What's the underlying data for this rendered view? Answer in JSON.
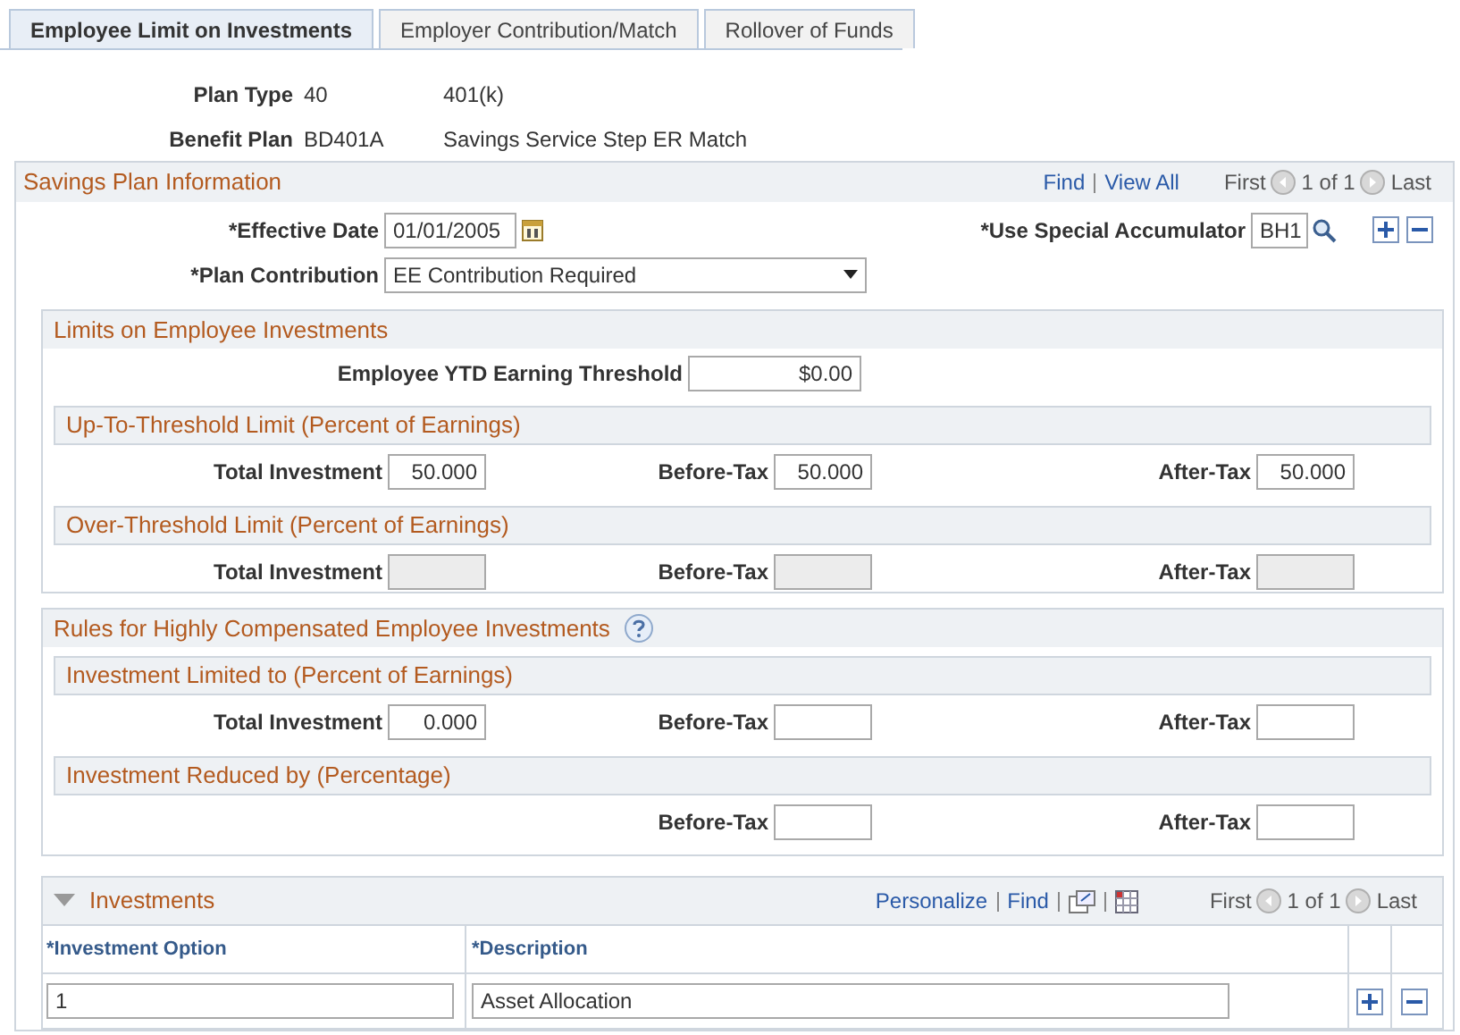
{
  "tabs": [
    {
      "label": "Employee Limit on Investments",
      "selected": true
    },
    {
      "label": "Employer Contribution/Match",
      "selected": false
    },
    {
      "label": "Rollover of Funds",
      "selected": false
    }
  ],
  "header": [
    {
      "label": "Plan Type",
      "code": "40",
      "description": "401(k)"
    },
    {
      "label": "Benefit Plan",
      "code": "BD401A",
      "description": "Savings Service Step ER Match"
    }
  ],
  "savings_plan": {
    "title": "Savings Plan Information",
    "find": "Find",
    "view_all": "View All",
    "first": "First",
    "count": "1 of 1",
    "last": "Last",
    "effective_date": {
      "label": "*Effective Date",
      "value": "01/01/2005"
    },
    "accumulator": {
      "label": "*Use Special Accumulator",
      "value": "BH1"
    },
    "plan_contribution": {
      "label": "*Plan Contribution",
      "value": "EE Contribution Required"
    }
  },
  "limits": {
    "title": "Limits on Employee Investments",
    "threshold": {
      "label": "Employee YTD Earning Threshold",
      "value": "$0.00"
    },
    "groups": [
      {
        "title": "Up-To-Threshold Limit (Percent of Earnings)",
        "fields": [
          {
            "label": "Total Investment",
            "value": "50.000",
            "disabled": false
          },
          {
            "label": "Before-Tax",
            "value": "50.000",
            "disabled": false
          },
          {
            "label": "After-Tax",
            "value": "50.000",
            "disabled": false
          }
        ]
      },
      {
        "title": "Over-Threshold Limit (Percent of Earnings)",
        "fields": [
          {
            "label": "Total Investment",
            "disabled": true
          },
          {
            "label": "Before-Tax",
            "disabled": true
          },
          {
            "label": "After-Tax",
            "disabled": true
          }
        ]
      }
    ]
  },
  "rules": {
    "title": "Rules for Highly Compensated Employee Investments",
    "groups": [
      {
        "title": "Investment Limited to (Percent of Earnings)",
        "fields": [
          {
            "label": "Total Investment",
            "value": "0.000",
            "disabled": false
          },
          {
            "label": "Before-Tax",
            "disabled": false
          },
          {
            "label": "After-Tax",
            "disabled": false
          }
        ]
      },
      {
        "title": "Investment Reduced by (Percentage)",
        "fields": [
          {
            "label": "Before-Tax",
            "disabled": false
          },
          {
            "label": "After-Tax",
            "disabled": false
          }
        ]
      }
    ]
  },
  "investments": {
    "title": "Investments",
    "expanded": true,
    "personalize": "Personalize",
    "find": "Find",
    "first": "First",
    "count": "1 of 1",
    "last": "Last",
    "columns": [
      "*Investment Option",
      "*Description"
    ],
    "rows": [
      {
        "option": "1",
        "description": "Asset Allocation"
      }
    ]
  }
}
